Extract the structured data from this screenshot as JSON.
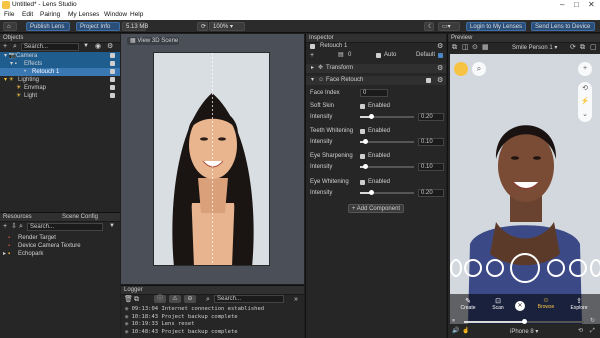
{
  "window": {
    "title": "Untitled* - Lens Studio"
  },
  "menu": [
    "File",
    "Edit",
    "Pairing",
    "My Lenses",
    "Window",
    "Help"
  ],
  "toolbar": {
    "publish_label": "Publish Lens",
    "project_info_label": "Project Info",
    "size_label": "5.13 MB",
    "zoom_value": "100%",
    "login_label": "Login to My Lenses",
    "send_label": "Send Lens to Device"
  },
  "objects": {
    "header": "Objects",
    "search_placeholder": "Search...",
    "items": [
      "Camera",
      "Effects",
      "Retouch 1",
      "Lighting",
      "Envmap",
      "Light"
    ]
  },
  "resources": {
    "header_tabs": [
      "Resources",
      "Scene Config"
    ],
    "search_placeholder": "Search...",
    "items": [
      "Render Target",
      "Device Camera Texture",
      "Echopark"
    ]
  },
  "scene": {
    "view_3d_label": "View 3D Scene"
  },
  "logger": {
    "header": "Logger",
    "search_placeholder": "Search...",
    "entries": [
      {
        "time": "09:13:04",
        "text": "Internet connection established"
      },
      {
        "time": "10:18:43",
        "text": "Project backup complete"
      },
      {
        "time": "10:19:33",
        "text": "Lens reset"
      },
      {
        "time": "10:48:43",
        "text": "Project backup complete"
      }
    ]
  },
  "inspector": {
    "header": "Inspector",
    "object_name": "Retouch 1",
    "layer_value": "0",
    "auto_label": "Auto",
    "default_label": "Default",
    "transform_label": "Transform",
    "component_label": "Face Retouch",
    "face_index_label": "Face Index",
    "face_index_value": "0",
    "enabled_label": "Enabled",
    "intensity_label": "Intensity",
    "add_component_label": "+ Add Component",
    "groups": [
      {
        "name": "Soft Skin",
        "value": "0.20",
        "level": 0.2
      },
      {
        "name": "Teeth Whitening",
        "value": "0.10",
        "level": 0.1
      },
      {
        "name": "Eye Sharpening",
        "value": "0.10",
        "level": 0.1
      },
      {
        "name": "Eye Whitening",
        "value": "0.20",
        "level": 0.2
      }
    ]
  },
  "preview": {
    "header": "Preview",
    "person_select": "Smile Person 1",
    "device": "iPhone 8",
    "carousel": [
      "Create",
      "Scan",
      "",
      "Browse",
      "Explore"
    ]
  },
  "colors": {
    "accent_blue": "#1f5d8f",
    "lens_yellow": "#f6c343",
    "selection": "#1f5d8f"
  }
}
